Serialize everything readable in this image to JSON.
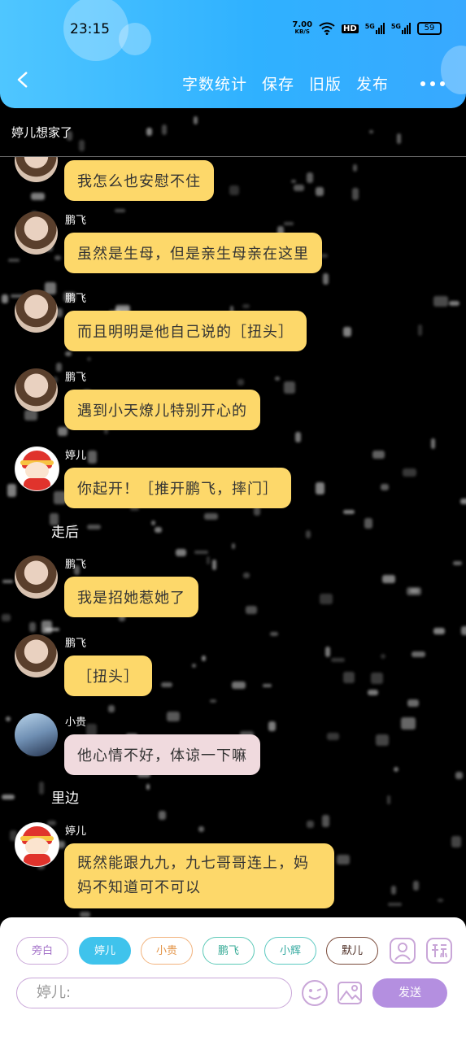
{
  "status_bar": {
    "time": "23:15",
    "net_speed_value": "7.00",
    "net_speed_unit": "KB/S",
    "hd": "HD",
    "sig1": "5G",
    "sig2": "5G",
    "battery": "59"
  },
  "header": {
    "menu": [
      "字数统计",
      "保存",
      "旧版",
      "发布"
    ]
  },
  "chat_title": "婷儿想家了",
  "messages": [
    {
      "speaker": "",
      "text": "我怎么也安慰不住",
      "avatar": "boy"
    },
    {
      "speaker": "鹏飞",
      "text": "虽然是生母，但是亲生母亲在这里",
      "avatar": "boy"
    },
    {
      "speaker": "鹏飞",
      "text": "而且明明是他自己说的［扭头］",
      "avatar": "boy"
    },
    {
      "speaker": "鹏飞",
      "text": "遇到小天燎儿特别开心的",
      "avatar": "boy"
    },
    {
      "speaker": "婷儿",
      "text": "你起开！［推开鹏飞，摔门］",
      "avatar": "girl"
    },
    {
      "speaker": "鹏飞",
      "text": "我是招她惹她了",
      "avatar": "boy"
    },
    {
      "speaker": "鹏飞",
      "text": "［扭头］",
      "avatar": "boy"
    },
    {
      "speaker": "小贵",
      "text": "他心情不好，体谅一下嘛",
      "avatar": "xg"
    },
    {
      "speaker": "婷儿",
      "text": "既然能跟九九，九七哥哥连上，妈妈不知道可不可以",
      "avatar": "girl"
    }
  ],
  "narrations": [
    "走后",
    "里边"
  ],
  "roles": [
    {
      "label": "旁白",
      "color": "#c9a6d8",
      "text_color": "#a574c9",
      "selected": false
    },
    {
      "label": "婷儿",
      "color": "#3fc3ec",
      "text_color": "#ffffff",
      "selected": true
    },
    {
      "label": "小贵",
      "color": "#f2b37d",
      "text_color": "#e39447",
      "selected": false
    },
    {
      "label": "鹏飞",
      "color": "#5cc9b7",
      "text_color": "#33a994",
      "selected": false
    },
    {
      "label": "小辉",
      "color": "#5cc9c1",
      "text_color": "#33a9a0",
      "selected": false
    },
    {
      "label": "默儿",
      "color": "#7a4a3a",
      "text_color": "#4a2a20",
      "selected": false
    }
  ],
  "input": {
    "placeholder": "婷儿:"
  },
  "send_label": "发送",
  "icons": [
    "back-icon",
    "more-icon",
    "person-icon",
    "label-icon",
    "emoji-icon",
    "image-icon"
  ],
  "colors": {
    "header": "#38b4ff",
    "bubble": "#fdd86a",
    "bubble_alt": "#f0dade",
    "send": "#b48fe0"
  }
}
